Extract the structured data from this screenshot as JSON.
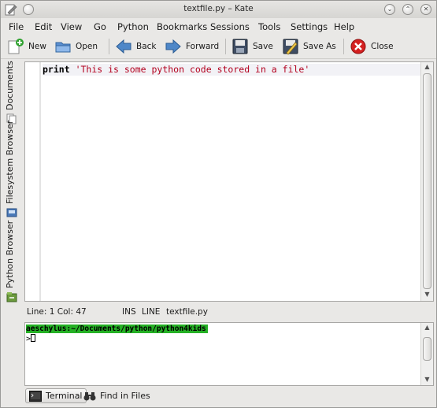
{
  "window": {
    "title": "textfile.py – Kate",
    "controls": {
      "minimize": "⌄",
      "maximize": "⌃",
      "close": "✕"
    }
  },
  "menu": [
    "File",
    "Edit",
    "View",
    "Go",
    "Python",
    "Bookmarks",
    "Sessions",
    "Tools",
    "Settings",
    "Help"
  ],
  "toolbar": {
    "new_label": "New",
    "open_label": "Open",
    "back_label": "Back",
    "forward_label": "Forward",
    "save_label": "Save",
    "save_as_label": "Save As",
    "close_label": "Close"
  },
  "side_tabs": {
    "documents": "Documents",
    "filesystem_browser": "Filesystem Browser",
    "python_browser": "Python Browser"
  },
  "editor": {
    "keyword": "print",
    "string": "'This is some python code stored in a file'"
  },
  "status": {
    "position": "Line: 1 Col: 47",
    "mode": "INS",
    "selection_mode": "LINE",
    "filename": "textfile.py"
  },
  "terminal": {
    "prompt_path": "aeschylus:~/Documents/python/python4kids",
    "prompt_symbol": ">"
  },
  "bottom_tabs": {
    "terminal": "Terminal",
    "find_in_files": "Find in Files"
  },
  "colors": {
    "prompt_bg": "#25b125",
    "string": "#b3001e",
    "close_icon": "#d42020"
  }
}
